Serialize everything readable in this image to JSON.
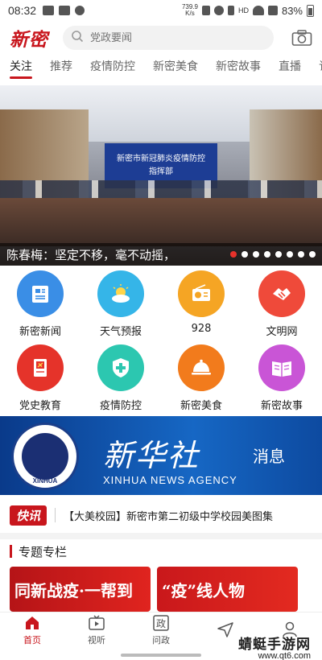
{
  "status_bar": {
    "time": "08:32",
    "net_speed": "739.9\nK/s",
    "hd": "HD",
    "battery": "83%"
  },
  "header": {
    "logo": "新密",
    "search_placeholder": "党政要闻"
  },
  "tabs": [
    {
      "label": "关注",
      "active": true
    },
    {
      "label": "推荐"
    },
    {
      "label": "疫情防控"
    },
    {
      "label": "新密美食"
    },
    {
      "label": "新密故事"
    },
    {
      "label": "直播"
    },
    {
      "label": "订阅"
    }
  ],
  "hero": {
    "screen_line1": "新密市新冠肺炎疫情防控",
    "screen_line2": "指挥部",
    "caption": "陈春梅：坚定不移，毫不动摇，",
    "dot_count": 8,
    "active_dot": 0
  },
  "grid": [
    {
      "label": "新密新闻",
      "icon": "news-doc-icon",
      "color": "#3a8ee6"
    },
    {
      "label": "天气预报",
      "icon": "weather-sun-cloud-icon",
      "color": "#35b5e8"
    },
    {
      "label": "928",
      "icon": "radio-icon",
      "color": "#f5a524"
    },
    {
      "label": "文明网",
      "icon": "handshake-icon",
      "color": "#ef4a3a"
    },
    {
      "label": "党史教育",
      "icon": "party-book-icon",
      "color": "#e5332a"
    },
    {
      "label": "疫情防控",
      "icon": "shield-cross-icon",
      "color": "#2cc7b0"
    },
    {
      "label": "新密美食",
      "icon": "food-dome-icon",
      "color": "#f27b1c"
    },
    {
      "label": "新密故事",
      "icon": "open-book-icon",
      "color": "#c955d6"
    }
  ],
  "banner": {
    "cn": "新华社",
    "msg": "消息",
    "en": "XINHUA NEWS AGENCY",
    "emblem_text": "XINHUA"
  },
  "flash": {
    "badge": "快讯",
    "text": "【大美校园】新密市第二初级中学校园美图集"
  },
  "special": {
    "title": "专题专栏",
    "cards": [
      "同新战疫·一帮到",
      "“疫”线人物"
    ]
  },
  "bottom_nav": [
    {
      "label": "首页",
      "icon": "home-icon",
      "active": true
    },
    {
      "label": "视听",
      "icon": "tv-icon"
    },
    {
      "label": "问政",
      "icon": "politics-icon"
    },
    {
      "label": "",
      "icon": "send-icon"
    },
    {
      "label": "",
      "icon": "user-icon"
    }
  ],
  "watermark": {
    "line1": "蜻蜓手游网",
    "line2": "www.qt6.com"
  }
}
